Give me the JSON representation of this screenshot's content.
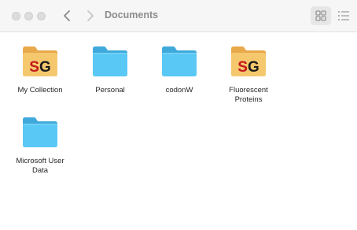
{
  "window": {
    "title": "Documents"
  },
  "toolbar": {
    "back_icon": "chevron-left-icon",
    "forward_icon": "chevron-right-icon",
    "icon_view_icon": "grid-view-icon",
    "list_view_icon": "list-view-icon"
  },
  "colors": {
    "folder_blue": "#5ac8f5",
    "folder_blue_tab": "#4fb3e2",
    "folder_orange": "#f5c86e",
    "sg_red": "#c4161c"
  },
  "items": [
    {
      "label": "My Collection",
      "icon": "snapgene-folder-icon",
      "badge": "SG"
    },
    {
      "label": "Personal",
      "icon": "folder-icon"
    },
    {
      "label": "codonW",
      "icon": "folder-icon"
    },
    {
      "label": "Fluorescent Proteins",
      "icon": "snapgene-folder-icon",
      "badge": "SG"
    },
    {
      "label": "Microsoft User Data",
      "icon": "folder-icon"
    }
  ]
}
